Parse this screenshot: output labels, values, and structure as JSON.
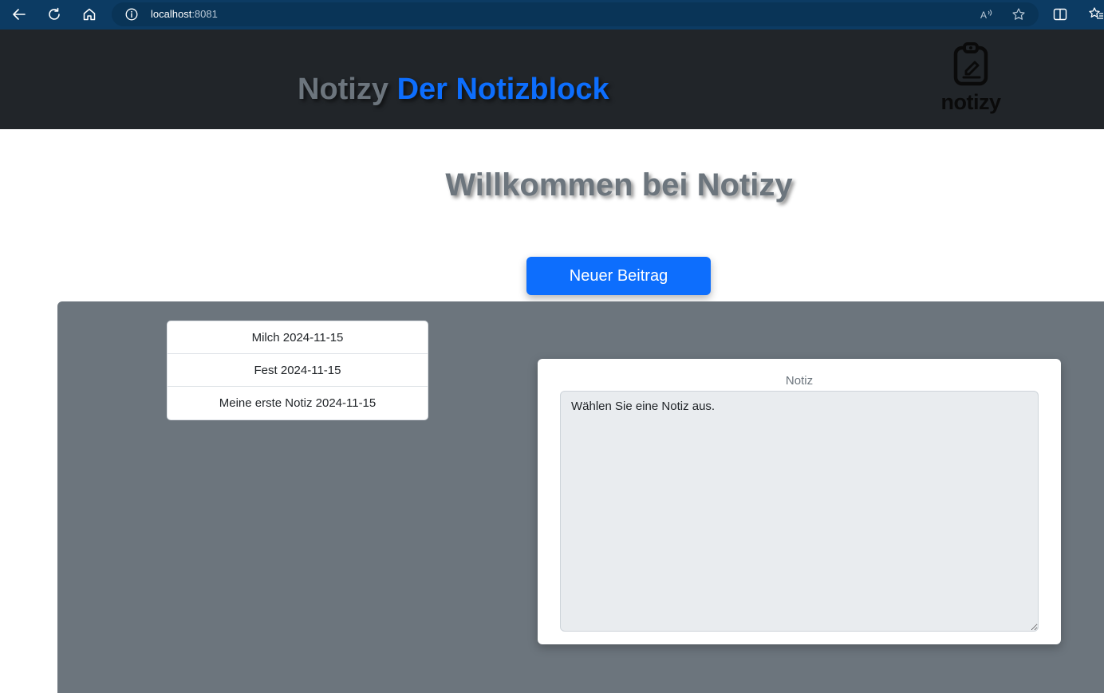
{
  "browser": {
    "url_host": "localhost",
    "url_port": ":8081"
  },
  "header": {
    "brand_name": "Notizy",
    "brand_sub": "Der Notizblock",
    "logo_text": "notizy"
  },
  "main": {
    "welcome": "Willkommen bei Notizy",
    "new_post_label": "Neuer Beitrag",
    "notes": [
      {
        "label": "Milch 2024-11-15"
      },
      {
        "label": "Fest 2024-11-15"
      },
      {
        "label": "Meine erste Notiz 2024-11-15"
      }
    ],
    "note_card": {
      "label": "Notiz",
      "textarea_value": "Wählen Sie eine Notiz aus."
    }
  },
  "colors": {
    "browser_bar": "#0c3b63",
    "header_bg": "#212529",
    "accent": "#0d6efd",
    "panel_bg": "#6c757d"
  },
  "icons": [
    "back-icon",
    "refresh-icon",
    "home-icon",
    "info-icon",
    "read-aloud-icon",
    "favorite-star-icon",
    "split-screen-icon",
    "favorites-list-icon",
    "clipboard-logo-icon"
  ]
}
